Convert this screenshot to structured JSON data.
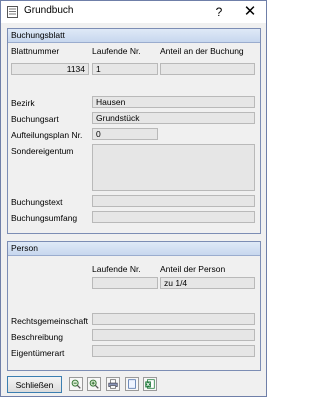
{
  "window": {
    "title": "Grundbuch",
    "help": "?",
    "close": "✕"
  },
  "buchungsblatt": {
    "header": "Buchungsblatt",
    "col_blattnummer": "Blattnummer",
    "col_laufende": "Laufende Nr.",
    "col_anteil": "Anteil an der Buchung",
    "blattnummer": "1134",
    "laufende": "1",
    "anteil": "",
    "bezirk_label": "Bezirk",
    "bezirk": "Hausen",
    "buchungsart_label": "Buchungsart",
    "buchungsart": "Grundstück",
    "aufteilungsplan_label": "Aufteilungsplan Nr.",
    "aufteilungsplan": "0",
    "sondereigentum_label": "Sondereigentum",
    "sondereigentum": "",
    "buchungstext_label": "Buchungstext",
    "buchungstext": "",
    "buchungsumfang_label": "Buchungsumfang",
    "buchungsumfang": ""
  },
  "person": {
    "header": "Person",
    "col_laufende": "Laufende Nr.",
    "col_anteil": "Anteil der Person",
    "laufende": "",
    "anteil": "zu 1/4",
    "rechtsgemeinschaft_label": "Rechtsgemeinschaft",
    "rechtsgemeinschaft": "",
    "beschreibung_label": "Beschreibung",
    "beschreibung": "",
    "eigentuemerart_label": "Eigentümerart",
    "eigentuemerart": ""
  },
  "toolbar": {
    "close_label": "Schließen"
  }
}
